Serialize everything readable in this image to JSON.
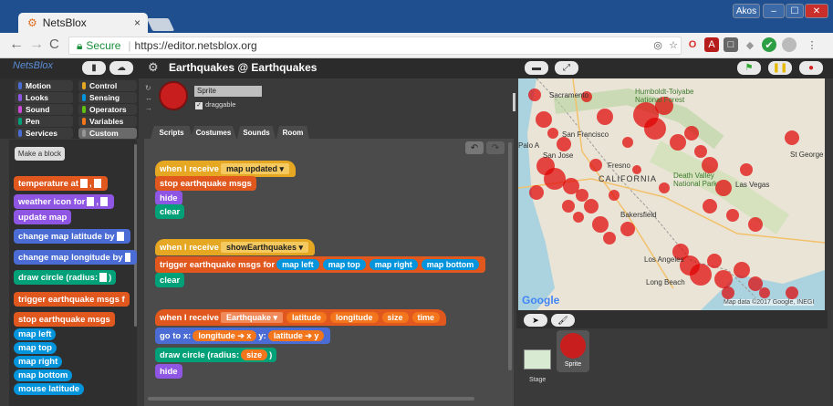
{
  "browser": {
    "tab_title": "NetsBlox",
    "tab_close": "×",
    "user_badge": "Akos",
    "secure_label": "Secure",
    "url": "https://editor.netsblox.org"
  },
  "app": {
    "logo": "NetsBlox",
    "project_title": "Earthquakes @ Earthquakes"
  },
  "categories": [
    {
      "label": "Motion",
      "color": "#4a6cd4"
    },
    {
      "label": "Control",
      "color": "#e6a822"
    },
    {
      "label": "Looks",
      "color": "#8f56e3"
    },
    {
      "label": "Sensing",
      "color": "#0494dc"
    },
    {
      "label": "Sound",
      "color": "#cf4ad9"
    },
    {
      "label": "Operators",
      "color": "#62c213"
    },
    {
      "label": "Pen",
      "color": "#00a178"
    },
    {
      "label": "Variables",
      "color": "#f3761d"
    },
    {
      "label": "Services",
      "color": "#4a6cd4"
    },
    {
      "label": "Custom",
      "color": "#969696"
    }
  ],
  "palette": {
    "make_block": "Make a block",
    "blocks": [
      {
        "label": "temperature at",
        "color": "#e1581f",
        "slots": 2
      },
      {
        "label": "weather icon for",
        "color": "#8f56e3",
        "slots": 2
      },
      {
        "label": "update map",
        "color": "#8f56e3",
        "slots": 0
      },
      {
        "label": "change map latitude by",
        "color": "#4a6cd4",
        "slots": 1
      },
      {
        "label": "change map longitude by",
        "color": "#4a6cd4",
        "slots": 1
      },
      {
        "label": "draw circle (radius:",
        "color": "#00a178",
        "slots": 1,
        "suffix": ")"
      },
      {
        "label": "trigger earthquake msgs f",
        "color": "#e1581f",
        "slots": 0
      },
      {
        "label": "stop earthquake msgs",
        "color": "#e1581f",
        "slots": 0
      },
      {
        "label": "map left",
        "color": "#0494dc",
        "slots": 0
      },
      {
        "label": "map top",
        "color": "#0494dc",
        "slots": 0
      },
      {
        "label": "map right",
        "color": "#0494dc",
        "slots": 0
      },
      {
        "label": "map bottom",
        "color": "#0494dc",
        "slots": 0
      },
      {
        "label": "mouse latitude",
        "color": "#0494dc",
        "slots": 0
      }
    ]
  },
  "sprite": {
    "name": "Sprite",
    "draggable_label": "draggable"
  },
  "editor_tabs": [
    "Scripts",
    "Costumes",
    "Sounds",
    "Room"
  ],
  "scripts": {
    "s1": {
      "hat": "when I receive",
      "msg": "map updated",
      "b1": "stop earthquake msgs",
      "b2": "hide",
      "b3": "clear"
    },
    "s2": {
      "hat": "when I receive",
      "msg": "showEarthquakes",
      "b1": "trigger earthquake msgs for",
      "args": [
        "map left",
        "map top",
        "map right",
        "map bottom"
      ],
      "b2": "clear"
    },
    "s3": {
      "hat": "when I receive",
      "msg": "Earthquake",
      "params": [
        "latitude",
        "longitude",
        "size",
        "time"
      ],
      "goto": "go to x:",
      "goto_x": "longitude",
      "goto_y_label": "y:",
      "goto_y": "latitude",
      "arrow": "➔ x",
      "arrow_y": "➔ y",
      "draw": "draw circle (radius:",
      "draw_arg": "size",
      "draw_end": ")",
      "b_hide": "hide"
    }
  },
  "map": {
    "labels": [
      "Sacramento",
      "Humboldt-Toiyabe National Forest",
      "San Francisco",
      "San Jose",
      "Fresno",
      "CALIFORNIA",
      "Death Valley National Park",
      "Las Vegas",
      "Bakersfield",
      "Los Angeles",
      "Long Beach",
      "Palo A",
      "St George"
    ],
    "google": "Google",
    "copyright": "Map data ©2017 Google, INEGI"
  },
  "corral": {
    "stage_label": "Stage",
    "sprite_label": "Sprite"
  }
}
